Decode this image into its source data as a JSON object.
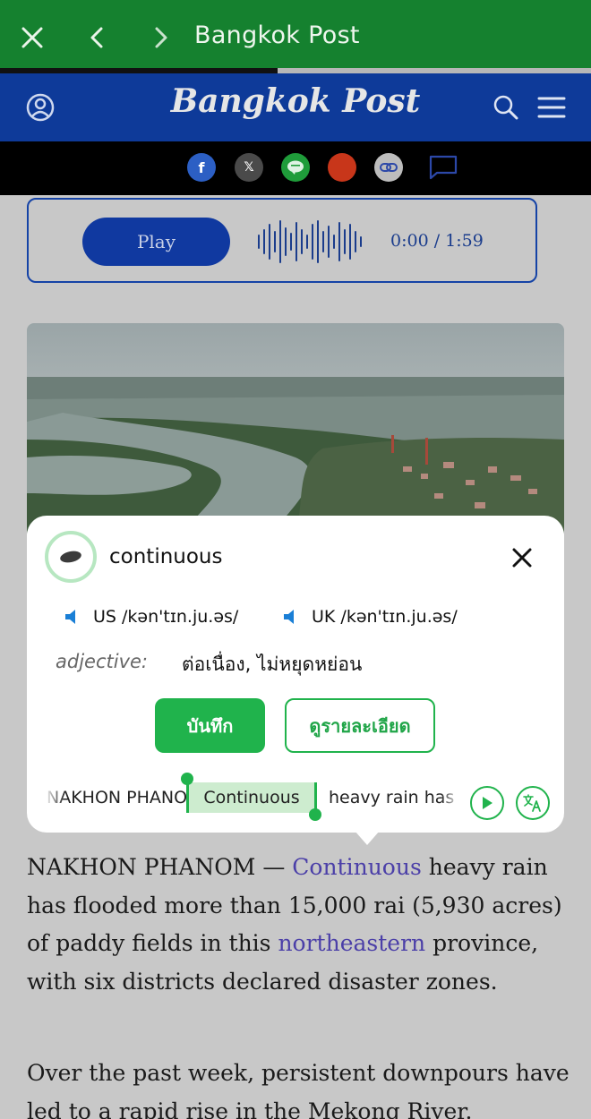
{
  "browser": {
    "title": "Bangkok Post",
    "icons": [
      "close-icon",
      "back-icon",
      "forward-icon"
    ],
    "progress": 0.47
  },
  "site": {
    "brand": "Bangkok Post",
    "icons": [
      "account-icon",
      "search-icon",
      "menu-icon"
    ]
  },
  "share": {
    "items": [
      "facebook-icon",
      "x-icon",
      "line-icon",
      "flipboard-icon",
      "copy-link-icon",
      "comment-icon"
    ]
  },
  "audio": {
    "play_label": "Play",
    "time": "0:00 / 1:59"
  },
  "popup": {
    "word": "continuous",
    "us_label": "US",
    "us_ipa": "/kən'tɪn.ju.əs/",
    "uk_label": "UK",
    "uk_ipa": "/kən'tɪn.ju.əs/",
    "part_of_speech": "adjective:",
    "meaning": "ต่อเนื่อง, ไม่หยุดหย่อน",
    "save_label": "บันทึก",
    "detail_label": "ดูรายละเอียด",
    "ticker_before": "NAKHON PHANOM —",
    "ticker_highlight": "Continuous",
    "ticker_after": "heavy rain has"
  },
  "article": {
    "p1": {
      "lines": [
        [
          "NAKHON PHANOM — ",
          "Continuous",
          " heavy rain"
        ],
        [
          "has flooded more than 15,000 rai (5,930 acres)"
        ],
        [
          "of paddy fields in this ",
          "northeastern",
          " province,"
        ],
        [
          "with six districts declared disaster zones."
        ]
      ]
    },
    "p2": {
      "line1": "Over the past week, persistent downpours have",
      "line2": "led to a rapid rise in the Mekong River."
    }
  },
  "colors": {
    "browser_green": "#15812f",
    "site_blue": "#0e3a99",
    "accent_green": "#20b34c",
    "link_purple": "#4b3fa8"
  }
}
